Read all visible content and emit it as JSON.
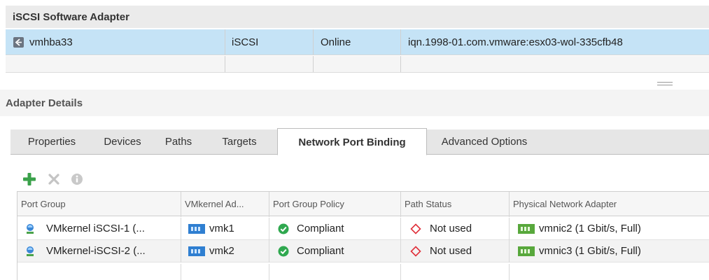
{
  "software_adapter": {
    "group_title": "iSCSI Software Adapter",
    "row": {
      "name": "vmhba33",
      "icon": "hba-adapter-icon",
      "type": "iSCSI",
      "status": "Online",
      "identifier": "iqn.1998-01.com.vmware:esx03-wol-335cfb48"
    }
  },
  "details": {
    "title": "Adapter Details"
  },
  "tabs": [
    {
      "label": "Properties",
      "active": false
    },
    {
      "label": "Devices",
      "active": false
    },
    {
      "label": "Paths",
      "active": false
    },
    {
      "label": "Targets",
      "active": false
    },
    {
      "label": "Network Port Binding",
      "active": true
    },
    {
      "label": "Advanced Options",
      "active": false
    }
  ],
  "toolbar": {
    "add_icon": "plus-icon",
    "remove_icon": "x-icon",
    "info_icon": "info-icon",
    "add_color": "#3aa14a"
  },
  "binding_table": {
    "columns": [
      "Port Group",
      "VMkernel Ad...",
      "Port Group Policy",
      "Path Status",
      "Physical Network Adapter"
    ],
    "rows": [
      {
        "port_group": "VMkernel iSCSI-1 (...",
        "vmkernel": "vmk1",
        "policy": "Compliant",
        "path_status": "Not used",
        "physical": "vmnic2 (1 Gbit/s, Full)"
      },
      {
        "port_group": "VMkernel-iSCSI-2 (...",
        "vmkernel": "vmk2",
        "policy": "Compliant",
        "path_status": "Not used",
        "physical": "vmnic3 (1 Gbit/s, Full)"
      }
    ]
  },
  "colors": {
    "selected_row": "#c5e3f6",
    "compliant_green": "#2fa84f",
    "not_used_red": "#e0303a"
  }
}
